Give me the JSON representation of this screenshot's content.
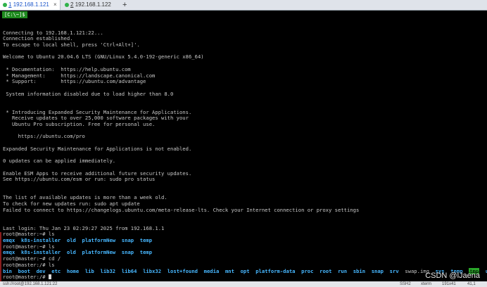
{
  "tabs": [
    {
      "num": "1",
      "label": "192.168.1.121"
    },
    {
      "num": "2",
      "label": "192.168.1.122"
    }
  ],
  "new_tab": "+",
  "local_prompt": "[C:\\~]$",
  "lines": [
    "",
    "Connecting to 192.168.1.121:22...",
    "Connection established.",
    "To escape to local shell, press 'Ctrl+Alt+]'.",
    "",
    "Welcome to Ubuntu 20.04.6 LTS (GNU/Linux 5.4.0-192-generic x86_64)",
    "",
    " * Documentation:  https://help.ubuntu.com",
    " * Management:     https://landscape.canonical.com",
    " * Support:        https://ubuntu.com/advantage",
    "",
    " System information disabled due to load higher than 8.0",
    "",
    "",
    " * Introducing Expanded Security Maintenance for Applications.",
    "   Receive updates to over 25,000 software packages with your",
    "   Ubuntu Pro subscription. Free for personal use.",
    "",
    "     https://ubuntu.com/pro",
    "",
    "Expanded Security Maintenance for Applications is not enabled.",
    "",
    "0 updates can be applied immediately.",
    "",
    "Enable ESM Apps to receive additional future security updates.",
    "See https://ubuntu.com/esm or run: sudo pro status",
    "",
    "",
    "The list of available updates is more than a week old.",
    "To check for new updates run: sudo apt update",
    "Failed to connect to https://changelogs.ubuntu.com/meta-release-lts. Check your Internet connection or proxy settings",
    "",
    "",
    "Last login: Thu Jan 23 02:29:27 2025 from 192.168.1.1"
  ],
  "shell": {
    "prompt1": "root@master:~# ",
    "cmd1": "ls",
    "ls1": [
      "emqx",
      "k8s-installer",
      "old",
      "platformNew",
      "snap",
      "temp"
    ],
    "prompt2": "root@master:~# ",
    "cmd2": "ls",
    "ls2": [
      "emqx",
      "k8s-installer",
      "old",
      "platformNew",
      "snap",
      "temp"
    ],
    "prompt3": "root@master:~# ",
    "cmd3": "cd /",
    "prompt4": "root@master:/# ",
    "cmd4": "ls",
    "ls_root": [
      "bin",
      "boot",
      "dev",
      "etc",
      "home",
      "lib",
      "lib32",
      "lib64",
      "libx32",
      "lost+found",
      "media",
      "mnt",
      "opt",
      "platform-data",
      "proc",
      "root",
      "run",
      "sbin",
      "snap",
      "srv",
      "swap.img",
      "sys",
      "temp",
      "tmp",
      "usr",
      "va"
    ],
    "prompt5": "root@master:/# "
  },
  "status_bar": {
    "path": "ssh://root@192.168.1.121:22",
    "protocol": "SSH2",
    "term": "xterm",
    "size": "191x41",
    "pos": "41,1"
  },
  "watermark": "CSDN @lJaena",
  "colors": {
    "dir": "#47b7ff",
    "file": "#c8c8c8",
    "highlight_dir": "#2aa82a",
    "active_tab": "#1a55c9"
  }
}
